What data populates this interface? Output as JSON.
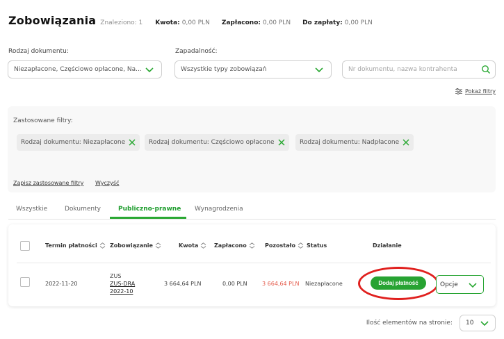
{
  "header": {
    "title": "Zobowiązania",
    "found": "Znaleziono: 1",
    "amount_label": "Kwota:",
    "amount_value": "0,00 PLN",
    "paid_label": "Zapłacono:",
    "paid_value": "0,00 PLN",
    "due_label": "Do zapłaty:",
    "due_value": "0,00 PLN"
  },
  "filters": {
    "doc_type_label": "Rodzaj dokumentu:",
    "doc_type_value": "Niezapłacone, Częściowo opłacone, Na...",
    "due_label": "Zapadalność:",
    "due_value": "Wszystkie typy zobowiązań",
    "search_placeholder": "Nr dokumentu, nazwa kontrahenta",
    "show_filters": "Pokaż filtry"
  },
  "applied": {
    "title": "Zastosowane filtry:",
    "chips": [
      "Rodzaj dokumentu: Niezapłacone",
      "Rodzaj dokumentu: Częściowo opłacone",
      "Rodzaj dokumentu: Nadpłacone"
    ],
    "save": "Zapisz zastosowane filtry",
    "clear": "Wyczyść"
  },
  "tabs": [
    "Wszystkie",
    "Dokumenty",
    "Publiczno-prawne",
    "Wynagrodzenia"
  ],
  "active_tab": "Publiczno-prawne",
  "table": {
    "headers": {
      "due_date": "Termin płatności",
      "obligation": "Zobowiązanie",
      "amount": "Kwota",
      "paid": "Zapłacono",
      "remaining": "Pozostało",
      "status": "Status",
      "action": "Działanie"
    },
    "rows": [
      {
        "due_date": "2022-11-20",
        "obligation_line1": "ZUS",
        "obligation_line2": "ZUS-DRA",
        "obligation_line3": "2022-10",
        "amount": "3 664,64 PLN",
        "paid": "0,00 PLN",
        "remaining": "3 664,64 PLN",
        "status": "Niezapłacone",
        "pay_button": "Dodaj płatność",
        "options_button": "Opcje"
      }
    ]
  },
  "pager": {
    "label": "Ilość elementów na stronie:",
    "value": "10"
  },
  "colors": {
    "accent": "#27a332",
    "remaining_red": "#e45a4a",
    "highlight_circle": "#e0201e"
  }
}
